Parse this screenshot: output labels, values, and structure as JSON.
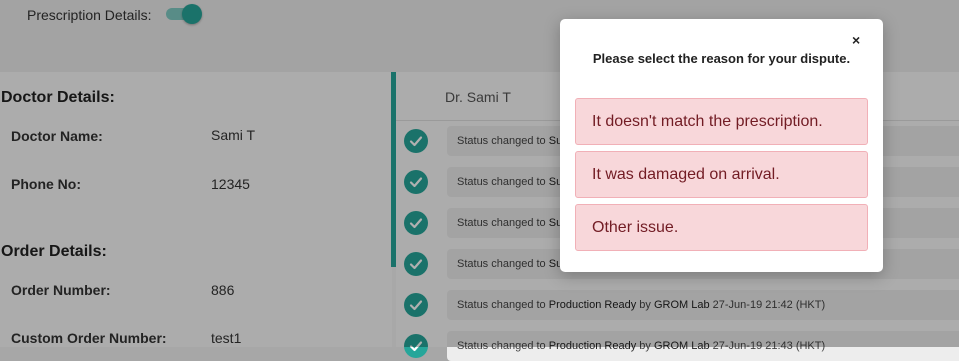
{
  "header": {
    "prescription_label": "Prescription Details:",
    "prescription_toggle_on": true
  },
  "doctor": {
    "title": "Doctor Details:",
    "name_label": "Doctor Name:",
    "name_value": "Sami T",
    "phone_label": "Phone No:",
    "phone_value": "12345"
  },
  "order": {
    "title": "Order Details:",
    "number_label": "Order Number:",
    "number_value": "886",
    "custom_label": "Custom Order Number:",
    "custom_value": "test1"
  },
  "timeline": {
    "tab": "Dr. Sami T",
    "rows": [
      {
        "prefix": "Status changed to",
        "status": "Su",
        "by": "",
        "lab": "",
        "time": ""
      },
      {
        "prefix": "Status changed to",
        "status": "Su",
        "by": "",
        "lab": "",
        "time": ""
      },
      {
        "prefix": "Status changed to",
        "status": "Su",
        "by": "",
        "lab": "",
        "time": ""
      },
      {
        "prefix": "Status changed to",
        "status": "Su",
        "by": "",
        "lab": "",
        "time": ""
      },
      {
        "prefix": "Status changed to",
        "status": "Production Ready",
        "by": "by",
        "lab": "GROM Lab",
        "time": "27-Jun-19 21:42 (HKT)"
      },
      {
        "prefix": "Status changed to",
        "status": "Production Ready",
        "by": "by",
        "lab": "GROM Lab",
        "time": "27-Jun-19 21:43 (HKT)"
      }
    ]
  },
  "modal": {
    "close": "×",
    "title": "Please select the reason for your dispute.",
    "options": [
      "It doesn't match the prescription.",
      "It was damaged on arrival.",
      "Other issue."
    ]
  },
  "colors": {
    "accent": "#26a69a",
    "alert_bg": "#f8d7da",
    "alert_text": "#721c24"
  },
  "icons": {
    "timeline_check": "check-circle-icon",
    "close": "close-icon"
  }
}
